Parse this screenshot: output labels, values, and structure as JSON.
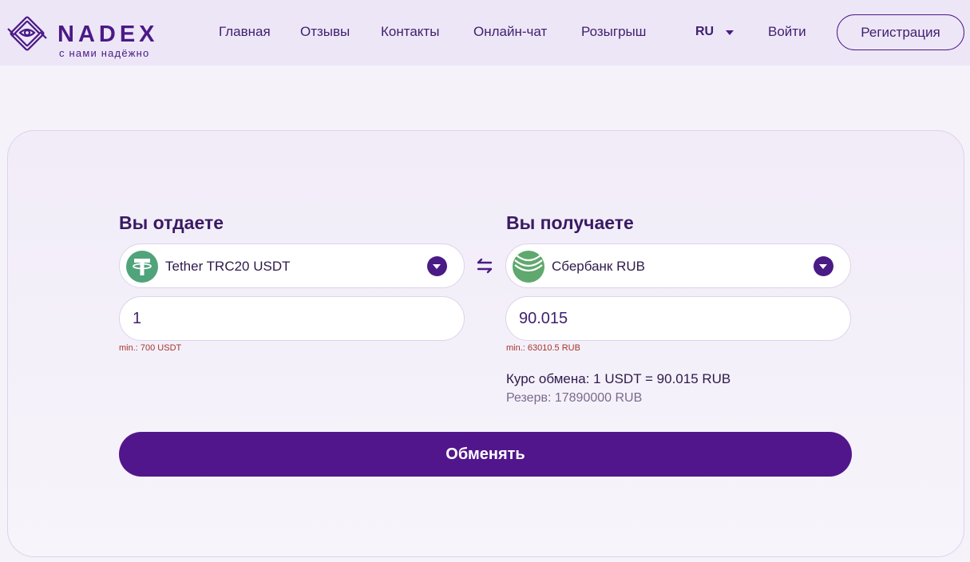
{
  "brand": {
    "name": "NADEX",
    "slogan": "с нами надёжно",
    "accent_color": "#4a1a86"
  },
  "nav": {
    "items": [
      "Главная",
      "Отзывы",
      "Контакты",
      "Онлайн-чат",
      "Розыгрыш"
    ],
    "language": "RU",
    "login_label": "Войти",
    "register_label": "Регистрация"
  },
  "exchange": {
    "give": {
      "title": "Вы отдаете",
      "currency": "Tether TRC20 USDT",
      "currency_icon": "tether-icon",
      "amount": "1",
      "min_note": "min.: 700 USDT"
    },
    "receive": {
      "title": "Вы получаете",
      "currency": "Сбербанк RUB",
      "currency_icon": "sberbank-icon",
      "amount": "90.015",
      "min_note": "min.: 63010.5 RUB"
    },
    "rate": "Курс обмена: 1 USDT = 90.015 RUB",
    "reserve": "Резерв: 17890000 RUB",
    "submit_label": "Обменять",
    "button_color": "#52168c"
  }
}
